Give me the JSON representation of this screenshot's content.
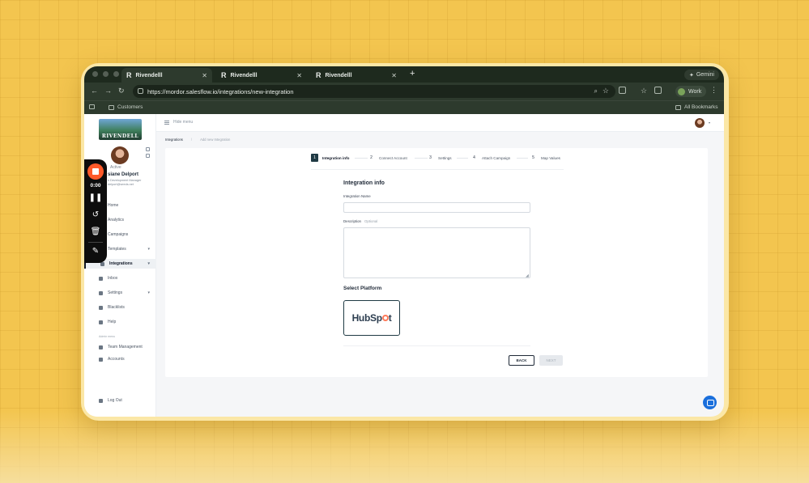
{
  "browser": {
    "tabs": [
      {
        "label": "Rivendelll"
      },
      {
        "label": "Rivendelll"
      },
      {
        "label": "Rivendelll"
      }
    ],
    "gemini_label": "Gemini",
    "url": "https://mordor.salesflow.io/integrations/new-integration",
    "profile_label": "Work",
    "bookmarks": {
      "customers": "Customers",
      "all": "All Bookmarks"
    }
  },
  "sidebar": {
    "logo_text": "RIVENDELL",
    "status": "Active",
    "user_name": "siane Delport",
    "user_role": "s Development Manager",
    "user_email": "delport@seeds.net",
    "items": [
      {
        "label": "Home"
      },
      {
        "label": "Analytics"
      },
      {
        "label": "Campaigns"
      },
      {
        "label": "Templates"
      },
      {
        "label": "Integrations"
      },
      {
        "label": "Inbox"
      },
      {
        "label": "Settings"
      },
      {
        "label": "Blacklists"
      },
      {
        "label": "Help"
      }
    ],
    "admin_label": "Admin menu",
    "admin_items": [
      {
        "label": "Team Management"
      },
      {
        "label": "Accounts"
      }
    ],
    "logout": "Log Out"
  },
  "recorder": {
    "time": "0:00"
  },
  "topbar": {
    "hide_menu": "Hide menu"
  },
  "breadcrumb": {
    "root": "Integrations",
    "separator": "/",
    "current": "Add new Integration"
  },
  "stepper": [
    {
      "num": "1",
      "label": "Integration info"
    },
    {
      "num": "2",
      "label": "Connect Account"
    },
    {
      "num": "3",
      "label": "Settings"
    },
    {
      "num": "4",
      "label": "Attach Campaign"
    },
    {
      "num": "5",
      "label": "Map Values"
    }
  ],
  "form": {
    "title": "Integration info",
    "name_label": "Integration Name",
    "name_value": "",
    "description_label": "Description",
    "description_optional": "Optional",
    "description_value": "",
    "platform_title": "Select Platform",
    "platform_hub": "HubSp",
    "platform_t": "t",
    "back": "BACK",
    "next": "NEXT"
  }
}
